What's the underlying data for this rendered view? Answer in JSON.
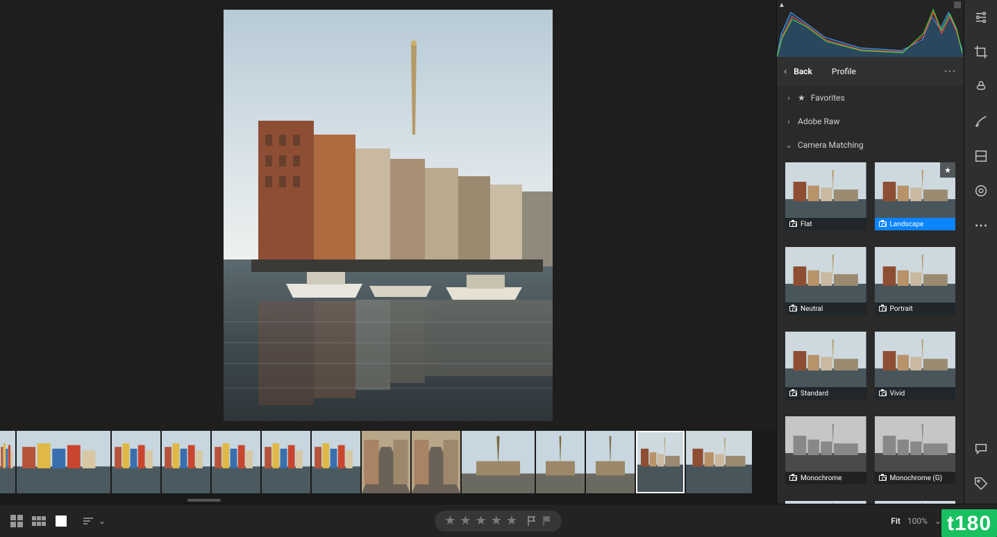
{
  "panel": {
    "back_label": "Back",
    "title": "Profile",
    "sections": {
      "favorites": "Favorites",
      "adobe_raw": "Adobe Raw",
      "camera_matching": "Camera Matching"
    },
    "profiles": [
      {
        "name": "Flat",
        "selected": false,
        "mono": false,
        "fav": false
      },
      {
        "name": "Landscape",
        "selected": true,
        "mono": false,
        "fav": true
      },
      {
        "name": "Neutral",
        "selected": false,
        "mono": false,
        "fav": false
      },
      {
        "name": "Portrait",
        "selected": false,
        "mono": false,
        "fav": false
      },
      {
        "name": "Standard",
        "selected": false,
        "mono": false,
        "fav": false
      },
      {
        "name": "Vivid",
        "selected": false,
        "mono": false,
        "fav": false
      },
      {
        "name": "Monochrome",
        "selected": false,
        "mono": true,
        "fav": false
      },
      {
        "name": "Monochrome (G)",
        "selected": false,
        "mono": true,
        "fav": false
      }
    ]
  },
  "toolbar": {
    "fit_label": "Fit",
    "zoom_pct": "100%"
  },
  "filmstrip": {
    "count": 14,
    "selected_index": 12
  },
  "rail_tools": [
    "edit",
    "crop",
    "healing",
    "brush",
    "linear-gradient",
    "radial-gradient",
    "more"
  ],
  "rail_bottom": [
    "comments",
    "tags"
  ],
  "watermark": "t180"
}
